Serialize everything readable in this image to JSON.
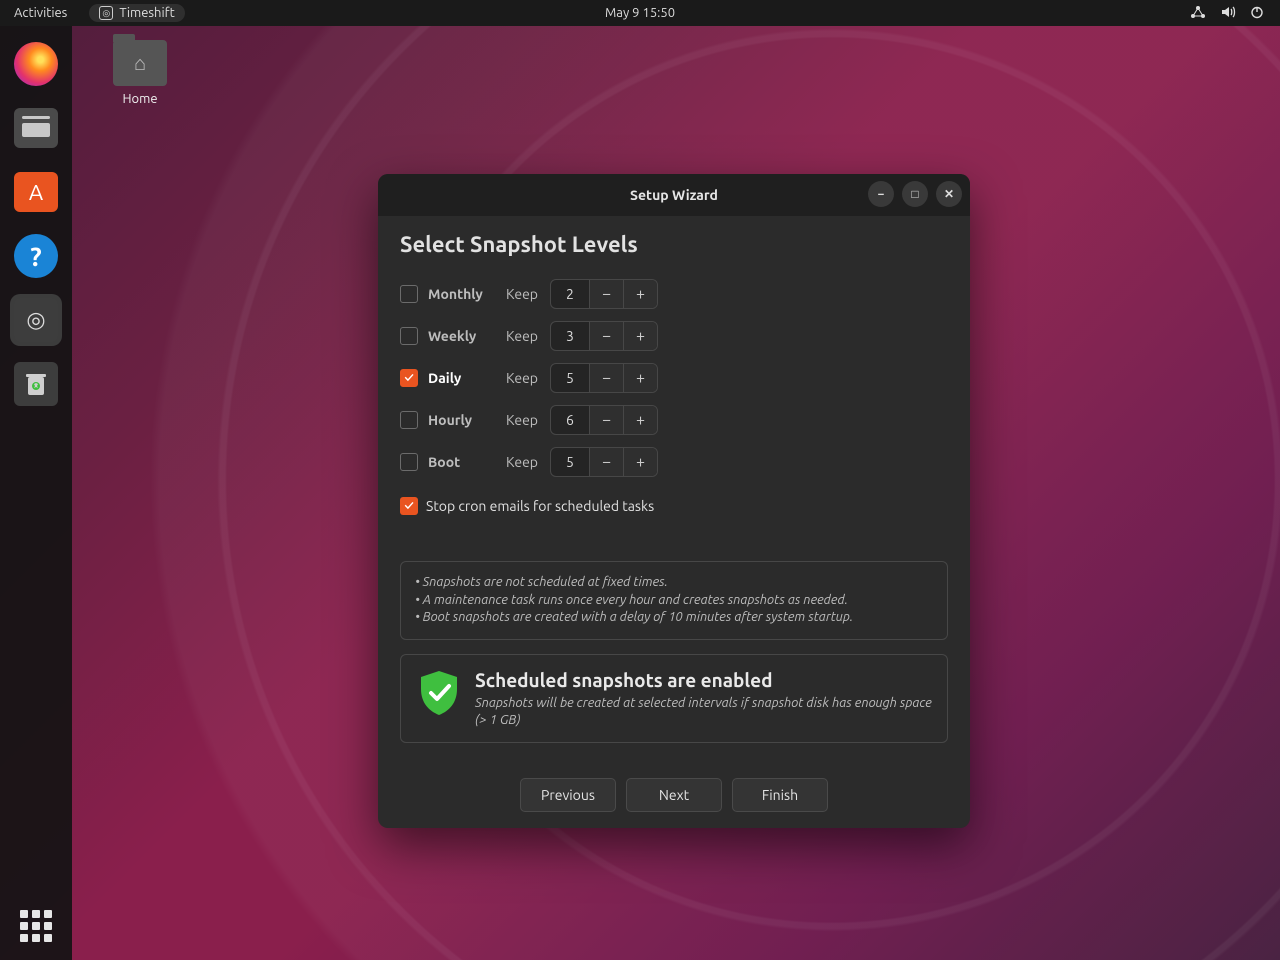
{
  "topbar": {
    "activities": "Activities",
    "app": "Timeshift",
    "clock": "May 9  15:50"
  },
  "desktop": {
    "home": "Home"
  },
  "window": {
    "title": "Setup Wizard",
    "heading": "Select Snapshot Levels",
    "levels": [
      {
        "name": "Monthly",
        "keep": "Keep",
        "value": "2",
        "checked": false
      },
      {
        "name": "Weekly",
        "keep": "Keep",
        "value": "3",
        "checked": false
      },
      {
        "name": "Daily",
        "keep": "Keep",
        "value": "5",
        "checked": true
      },
      {
        "name": "Hourly",
        "keep": "Keep",
        "value": "6",
        "checked": false
      },
      {
        "name": "Boot",
        "keep": "Keep",
        "value": "5",
        "checked": false
      }
    ],
    "stop_cron": "Stop cron emails for scheduled tasks",
    "note1": "• Snapshots are not scheduled at fixed times.",
    "note2": "• A maintenance task runs once every hour and creates snapshots as needed.",
    "note3": "• Boot snapshots are created with a delay of 10 minutes after system startup.",
    "status_title": "Scheduled snapshots are enabled",
    "status_body": "Snapshots will be created at selected intervals if snapshot disk has enough space (> 1 GB)",
    "previous": "Previous",
    "next": "Next",
    "finish": "Finish"
  }
}
